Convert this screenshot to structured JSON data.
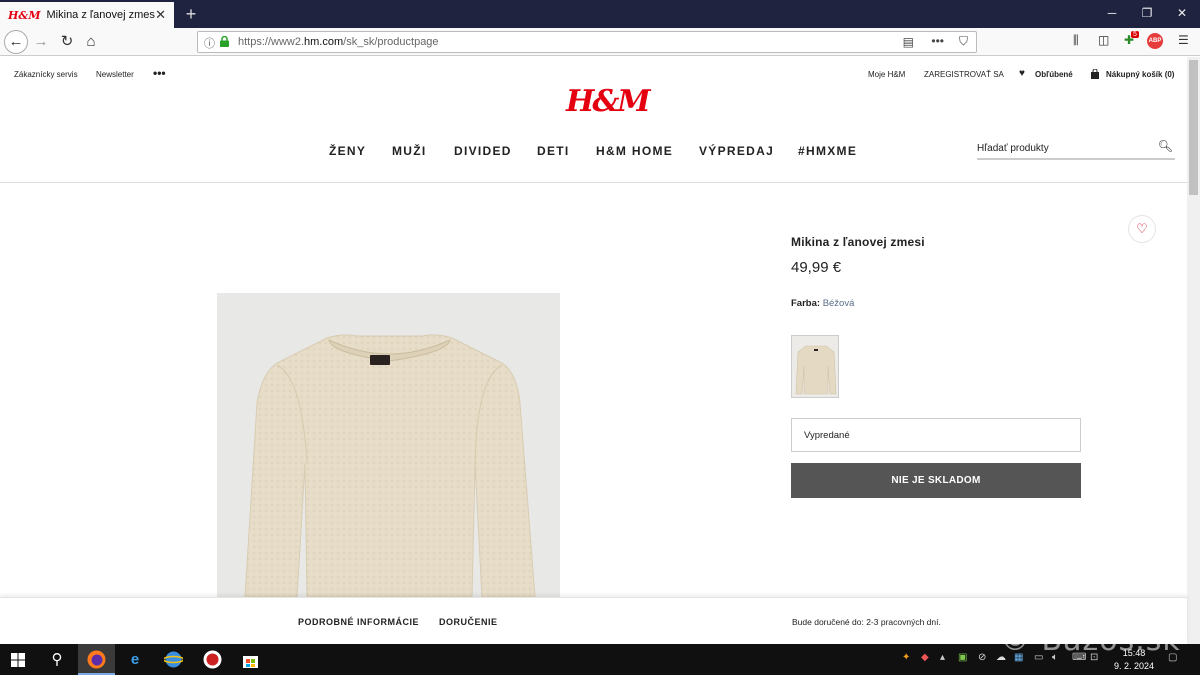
{
  "browser": {
    "tab_title": "Mikina z ľanovej zmesi",
    "tab_favicon": "H&M",
    "url_prefix": "https://www2.",
    "url_domain": "hm.com",
    "url_path": "/sk_sk/productpage",
    "notification_count": "5",
    "abp_label": "ABP"
  },
  "header": {
    "utility_left": [
      "Zákaznícky servis",
      "Newsletter"
    ],
    "utility_right": {
      "account": "Moje H&M",
      "register": "ZAREGISTROVAŤ SA",
      "favorites": "Obľúbené",
      "cart": "Nákupný košík (0)"
    },
    "logo": "H&M",
    "nav": [
      "ŽENY",
      "MUŽI",
      "DIVIDED",
      "DETI",
      "H&M HOME",
      "VÝPREDAJ",
      "#HMXME"
    ],
    "search_placeholder": "Hľadať produkty"
  },
  "product": {
    "title": "Mikina z ľanovej zmesi",
    "price": "49,99 €",
    "color_label": "Farba:",
    "color_value": "Béžová",
    "size_select": "Vypredané",
    "stock_button": "NIE JE SKLADOM"
  },
  "bottom": {
    "tabs": [
      "PODROBNÉ INFORMÁCIE",
      "DORUČENIE"
    ],
    "delivery_note": "Bude doručené do: 2-3 pracovných dní."
  },
  "taskbar": {
    "time": "15:48",
    "date": "9. 2. 2024"
  },
  "watermark": "© Bazos.sk",
  "colors": {
    "brand_red": "#e50010",
    "button_gray": "#555555",
    "link_blue": "#5a6c88"
  }
}
